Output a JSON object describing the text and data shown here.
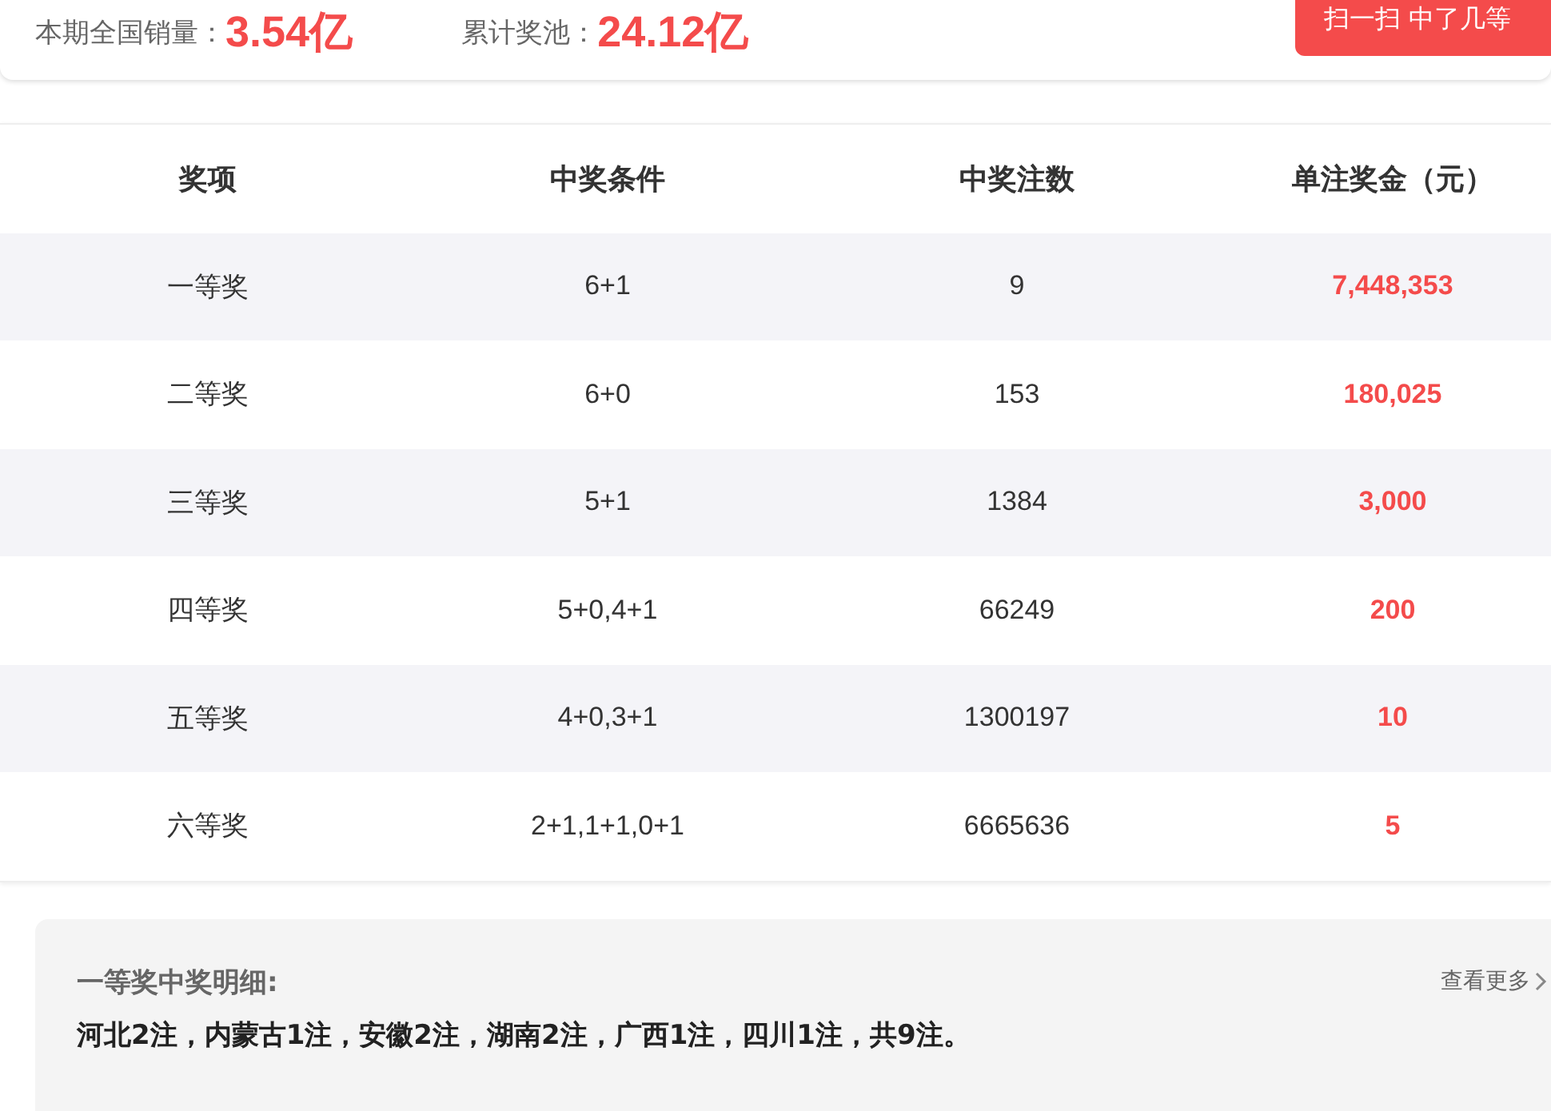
{
  "summary": {
    "sales_label": "本期全国销量：",
    "sales_value": "3.54亿",
    "pool_label": "累计奖池：",
    "pool_value": "24.12亿",
    "scan_button": "扫一扫 中了几等"
  },
  "table": {
    "columns": [
      "奖项",
      "中奖条件",
      "中奖注数",
      "单注奖金（元）"
    ],
    "rows": [
      {
        "prize": "一等奖",
        "condition": "6+1",
        "count": "9",
        "amount": "7,448,353"
      },
      {
        "prize": "二等奖",
        "condition": "6+0",
        "count": "153",
        "amount": "180,025"
      },
      {
        "prize": "三等奖",
        "condition": "5+1",
        "count": "1384",
        "amount": "3,000"
      },
      {
        "prize": "四等奖",
        "condition": "5+0,4+1",
        "count": "66249",
        "amount": "200"
      },
      {
        "prize": "五等奖",
        "condition": "4+0,3+1",
        "count": "1300197",
        "amount": "10"
      },
      {
        "prize": "六等奖",
        "condition": "2+1,1+1,0+1",
        "count": "6665636",
        "amount": "5"
      }
    ]
  },
  "details": {
    "title": "一等奖中奖明细:",
    "more": "查看更多",
    "text": "河北2注，内蒙古1注，安徽2注，湖南2注，广西1注，四川1注，共9注。"
  }
}
